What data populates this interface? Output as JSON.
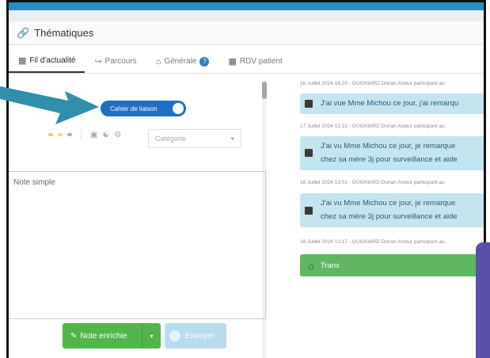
{
  "app": {
    "title": "Thématiques",
    "title_icon": "link-icon"
  },
  "tabs": [
    {
      "label": "Fil d'actualité",
      "icon": "newspaper-icon",
      "active": true
    },
    {
      "label": "Parcours",
      "icon": "route-icon",
      "active": false
    },
    {
      "label": "Générale",
      "icon": "home-icon",
      "active": false
    },
    {
      "label": "RDV patient",
      "icon": "grid-icon",
      "active": false
    }
  ],
  "left": {
    "toggle_label": "Cahier de liaison",
    "category_placeholder": "Catégorie",
    "note_placeholder": "Note simple",
    "rich_note_label": "Note enrichie",
    "send_label": "Envoyer"
  },
  "feed": [
    {
      "meta": "16 Juillet 2024 16:29 - GUIGNARD Dorian Acteur participant au",
      "lines": [
        "J'ai vue Mme Michou ce jour, j'ai remarqu"
      ]
    },
    {
      "meta": "17 Juillet 2024 12:12 - GUIGNARD Dorian Acteur participant au",
      "lines": [
        "J'ai vu Mme Michou ce jour, je remarque",
        "chez sa mère 3j pour surveillance et aide"
      ]
    },
    {
      "meta": "18 Juillet 2024 13:01 - GUIGNARD Dorian Acteur participant au",
      "lines": [
        "J'ai vu Mme Michou ce jour, je remarque",
        "chez sa mère 3j pour surveillance et aide"
      ]
    },
    {
      "meta": "18 Juillet 2024 13:17 - GUIGNARD Dorian Acteur participant au",
      "lines": []
    }
  ],
  "status_bar": {
    "label": "Trans",
    "icon": "home-icon"
  },
  "colors": {
    "primary": "#1f6fc2",
    "success": "#52b54a",
    "bubble": "#c4e5ef",
    "arrow": "#2f8fad",
    "accent_purple": "#5a4fa8"
  }
}
